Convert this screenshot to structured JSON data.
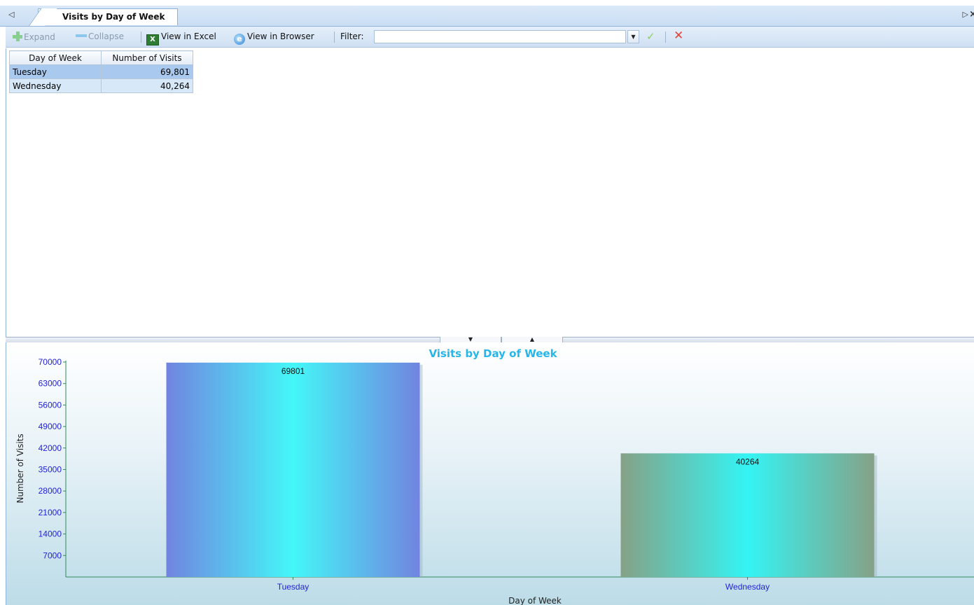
{
  "tab": {
    "nav_left": "◁",
    "title": "Visits by Day of Week",
    "nav_right": "▷",
    "close": "×"
  },
  "toolbar": {
    "expand": "Expand",
    "collapse": "Collapse",
    "view_excel": "View in Excel",
    "view_browser": "View in Browser",
    "filter_label": "Filter:",
    "filter_value": ""
  },
  "grid": {
    "columns": [
      "Day of Week",
      "Number of Visits"
    ],
    "rows": [
      {
        "day": "Tuesday",
        "visits": "69,801"
      },
      {
        "day": "Wednesday",
        "visits": "40,264"
      }
    ]
  },
  "chart_data": {
    "type": "bar",
    "title": "Visits by Day of Week",
    "xlabel": "Day of Week",
    "ylabel": "Number of Visits",
    "categories": [
      "Tuesday",
      "Wednesday"
    ],
    "values": [
      69801,
      40264
    ],
    "value_labels": [
      "69801",
      "40264"
    ],
    "ylim": [
      0,
      70000
    ],
    "yticks": [
      7000,
      14000,
      21000,
      28000,
      35000,
      42000,
      49000,
      56000,
      63000,
      70000
    ],
    "ytick_labels": [
      "7000",
      "14000",
      "21000",
      "28000",
      "35000",
      "42000",
      "49000",
      "56000",
      "63000",
      "70000"
    ],
    "grid": false,
    "legend": "none",
    "colors": {
      "title": "#27b6ea",
      "tick_labels": "#1f1fd8",
      "axis_line": "#2e8b57",
      "bar1_edge": "#7184e0",
      "bar1_center": "#44f7f8",
      "bar2_edge": "#86a186",
      "bar2_center": "#34f4f4"
    }
  }
}
